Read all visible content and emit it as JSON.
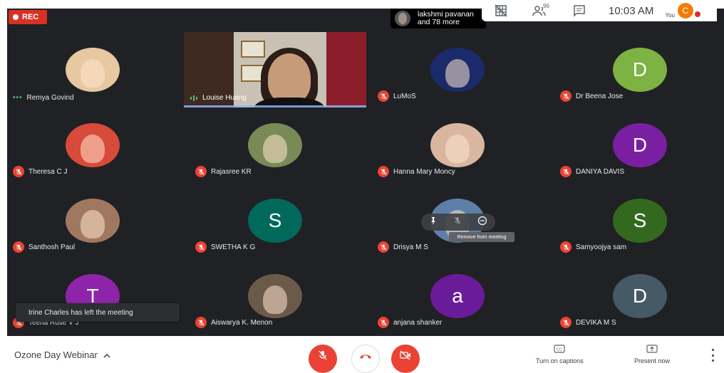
{
  "recording": {
    "label": "REC"
  },
  "presenter_chip": {
    "line1": "lakshmi pavanan",
    "line2": "and 78 more"
  },
  "topbar": {
    "icons": [
      "grid-off-icon",
      "people-icon",
      "chat-icon"
    ],
    "people_count": "96",
    "time": "10:03 AM",
    "you_label": "You",
    "you_initial": "C"
  },
  "featured_video": {
    "name": "Louise Huang",
    "speaking": true
  },
  "tiles": [
    {
      "name": "Remya Govind",
      "muted": false,
      "avatar": "photo",
      "color": "#e7c8a0"
    },
    {
      "name": "LuMoS",
      "muted": true,
      "avatar": "photo",
      "color": "#1b2a6b"
    },
    {
      "name": "Dr Beena Jose",
      "muted": true,
      "avatar": "letter",
      "letter": "D",
      "color": "#7cb342"
    },
    {
      "name": "Theresa C J",
      "muted": true,
      "avatar": "photo",
      "color": "#d84a3a"
    },
    {
      "name": "Rajasree KR",
      "muted": true,
      "avatar": "photo",
      "color": "#7a8a56"
    },
    {
      "name": "Hanna Mary Moncy",
      "muted": true,
      "avatar": "photo",
      "color": "#d8b6a0"
    },
    {
      "name": "DANIYA DAVIS",
      "muted": true,
      "avatar": "letter",
      "letter": "D",
      "color": "#7b1fa2"
    },
    {
      "name": "Santhosh Paul",
      "muted": true,
      "avatar": "photo",
      "color": "#a07860"
    },
    {
      "name": "SWETHA K G",
      "muted": true,
      "avatar": "letter",
      "letter": "S",
      "color": "#00695c"
    },
    {
      "name": "Drisya M S",
      "muted": true,
      "avatar": "photo",
      "color": "#5e7fa8"
    },
    {
      "name": "Samyoojya sam",
      "muted": true,
      "avatar": "letter",
      "letter": "S",
      "color": "#33691e"
    },
    {
      "name": "Teena Rose V J",
      "muted": true,
      "avatar": "letter",
      "letter": "T",
      "color": "#8e24aa"
    },
    {
      "name": "Aiswarya K. Menon",
      "muted": true,
      "avatar": "photo",
      "color": "#6b5a4a"
    },
    {
      "name": "anjana shanker",
      "muted": true,
      "avatar": "letter",
      "letter": "a",
      "color": "#6a1b9a"
    },
    {
      "name": "DEVIKA M S",
      "muted": true,
      "avatar": "letter",
      "letter": "D",
      "color": "#455a64"
    }
  ],
  "hover_controls": {
    "tooltip": "Remove from meeting",
    "icons": [
      "pin-icon",
      "mute-icon",
      "remove-icon"
    ]
  },
  "toast": {
    "text": "Irine Charles has left the meeting"
  },
  "bottombar": {
    "meeting_title": "Ozone Day Webinar",
    "captions_label": "Turn on captions",
    "present_label": "Present now",
    "controls": [
      "mic-off-icon",
      "end-call-icon",
      "camera-off-icon"
    ]
  },
  "colors": {
    "background": "#202124",
    "muted_red": "#ea4335",
    "accent_blue": "#8ab4f8"
  }
}
